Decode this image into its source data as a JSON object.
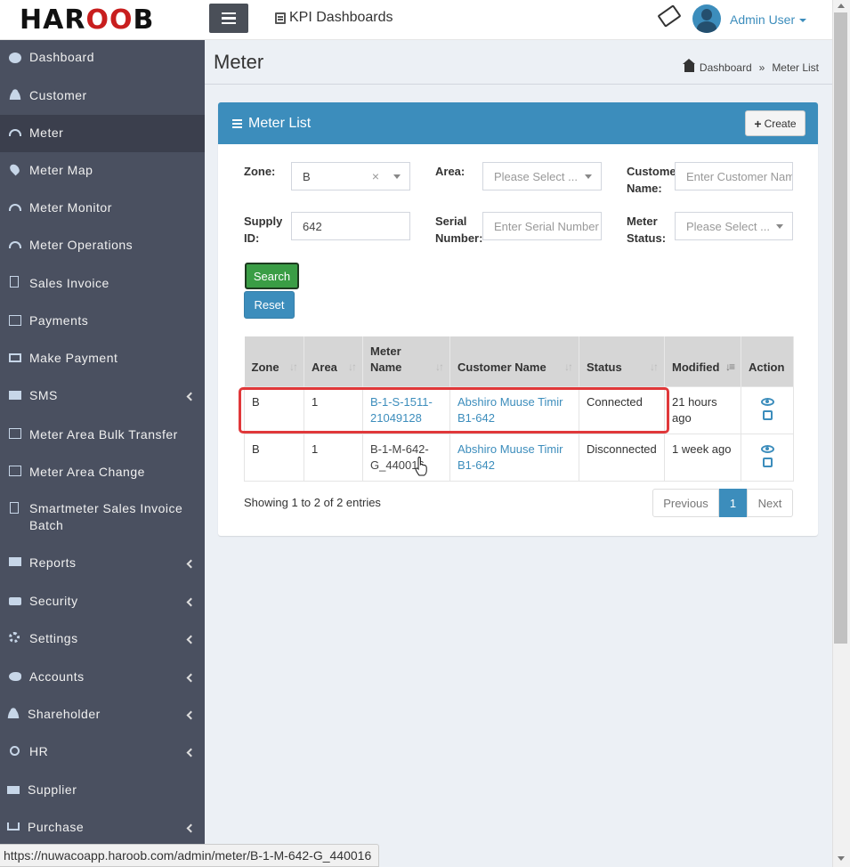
{
  "header": {
    "logo": {
      "part1": "HAR",
      "part2": "OO",
      "part3": "B"
    },
    "kpi_label": "KPI Dashboards",
    "user_name": "Admin User"
  },
  "sidebar": {
    "items": [
      {
        "label": "Dashboard",
        "icon": "pie-chart-icon"
      },
      {
        "label": "Customer",
        "icon": "user-icon"
      },
      {
        "label": "Meter",
        "icon": "gauge-icon",
        "active": true
      },
      {
        "label": "Meter Map",
        "icon": "map-pin-icon"
      },
      {
        "label": "Meter Monitor",
        "icon": "gauge-icon"
      },
      {
        "label": "Meter Operations",
        "icon": "gauge-icon"
      },
      {
        "label": "Sales Invoice",
        "icon": "document-icon"
      },
      {
        "label": "Payments",
        "icon": "credit-card-icon"
      },
      {
        "label": "Make Payment",
        "icon": "credit-card-icon"
      },
      {
        "label": "SMS",
        "icon": "sms-icon",
        "submenu": true
      },
      {
        "label": "Meter Area Bulk Transfer",
        "icon": "external-link-icon"
      },
      {
        "label": "Meter Area Change",
        "icon": "external-link-icon"
      },
      {
        "label": "Smartmeter Sales Invoice",
        "label2": "Batch",
        "icon": "document-icon"
      },
      {
        "label": "Reports",
        "icon": "reports-icon",
        "submenu": true
      },
      {
        "label": "Security",
        "icon": "lock-icon",
        "submenu": true
      },
      {
        "label": "Settings",
        "icon": "gear-icon",
        "submenu": true
      },
      {
        "label": "Accounts",
        "icon": "piggy-bank-icon",
        "submenu": true
      },
      {
        "label": "Shareholder",
        "icon": "user-icon",
        "submenu": true
      },
      {
        "label": "HR",
        "icon": "award-icon",
        "submenu": true
      },
      {
        "label": "Supplier",
        "icon": "truck-icon"
      },
      {
        "label": "Purchase",
        "icon": "cart-icon",
        "submenu": true
      }
    ]
  },
  "page": {
    "title": "Meter",
    "breadcrumb": {
      "home": "Dashboard",
      "separator": "»",
      "current": "Meter List"
    }
  },
  "box": {
    "title": "Meter List",
    "create_label": "Create"
  },
  "filters": {
    "zone": {
      "label": "Zone:",
      "value": "B",
      "clear": "×"
    },
    "area": {
      "label": "Area:",
      "placeholder": "Please Select ..."
    },
    "customer_name": {
      "label1": "Customer",
      "label2": "Name:",
      "placeholder": "Enter Customer Name"
    },
    "supply_id": {
      "label1": "Supply",
      "label2": "ID:",
      "value": "642"
    },
    "serial_number": {
      "label1": "Serial",
      "label2": "Number:",
      "placeholder": "Enter Serial Number"
    },
    "meter_status": {
      "label1": "Meter",
      "label2": "Status:",
      "placeholder": "Please Select ..."
    },
    "search_label": "Search",
    "reset_label": "Reset"
  },
  "table": {
    "columns": {
      "zone": "Zone",
      "area": "Area",
      "meter_name1": "Meter",
      "meter_name2": "Name",
      "customer_name": "Customer Name",
      "status": "Status",
      "modified": "Modified",
      "action": "Action"
    },
    "rows": [
      {
        "zone": "B",
        "area": "1",
        "meter_name1": "B-1-S-1511-",
        "meter_name2": "21049128",
        "customer1": "Abshiro Muuse Timir",
        "customer2": "B1-642",
        "status": "Connected",
        "modified": "21 hours ago"
      },
      {
        "zone": "B",
        "area": "1",
        "meter_name1": "B-1-M-642-",
        "meter_name2": "G_440016",
        "customer1": "Abshiro Muuse Timir",
        "customer2": "B1-642",
        "status": "Disconnected",
        "modified": "1 week ago"
      }
    ]
  },
  "footer": {
    "showing": "Showing 1 to 2 of 2 entries",
    "previous": "Previous",
    "page": "1",
    "next": "Next"
  },
  "statusbar": {
    "url": "https://nuwacoapp.haroob.com/admin/meter/B-1-M-642-G_440016"
  },
  "colors": {
    "primary": "#3c8dbc",
    "sidebar": "#4a5060",
    "success": "#3a9d45",
    "highlight": "#e0383a"
  }
}
